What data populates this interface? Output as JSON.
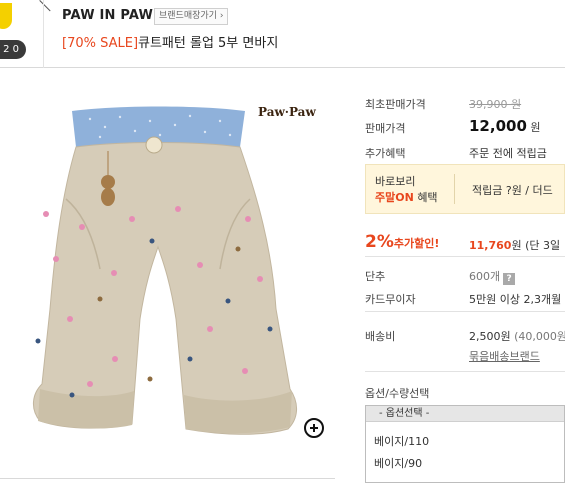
{
  "header": {
    "badge_text": "2 0",
    "brand": "PAW IN PAW",
    "brand_store_button": "브랜드매장가기 ›",
    "title_sale": "[70% SALE]",
    "title_text": "큐트패턴 롤업 5부 면바지"
  },
  "product_image": {
    "logo": "Paw·Paw",
    "zoom_icon": "zoom-plus-icon"
  },
  "info": {
    "original_price_label": "최초판매가격",
    "original_price": "39,900 원",
    "sale_price_label": "판매가격",
    "sale_price": "12,000",
    "sale_price_unit": "원",
    "extra_benefit_label": "추가혜택",
    "extra_benefit": "주문 전에 적립금",
    "promo_line1": "바로보리",
    "promo_line2_highlight": "주말ON",
    "promo_line2_rest": "혜택",
    "promo_reward": "적립금 ?원 / 더드",
    "discount_pct": "2%",
    "discount_label": "추가할인!",
    "discount_price": "11,760",
    "discount_suffix": "원 (단 3일",
    "unit_label": "단추",
    "unit_value": "600개",
    "card_label": "카드무이자",
    "card_value": "5만원 이상 2,3개월",
    "shipping_label": "배송비",
    "shipping_value": "2,500원",
    "shipping_note": "(40,000원",
    "bundle_link": "묶음배송브랜드",
    "option_title": "옵션/수량선택",
    "option_select": "- 옵션선택 -",
    "options": [
      "베이지/110",
      "베이지/90"
    ]
  },
  "colors": {
    "accent": "#e8471e",
    "promo_bg": "#fff6dc",
    "pants_khaki": "#d6ccb8",
    "waistband_blue": "#8fb1da"
  }
}
